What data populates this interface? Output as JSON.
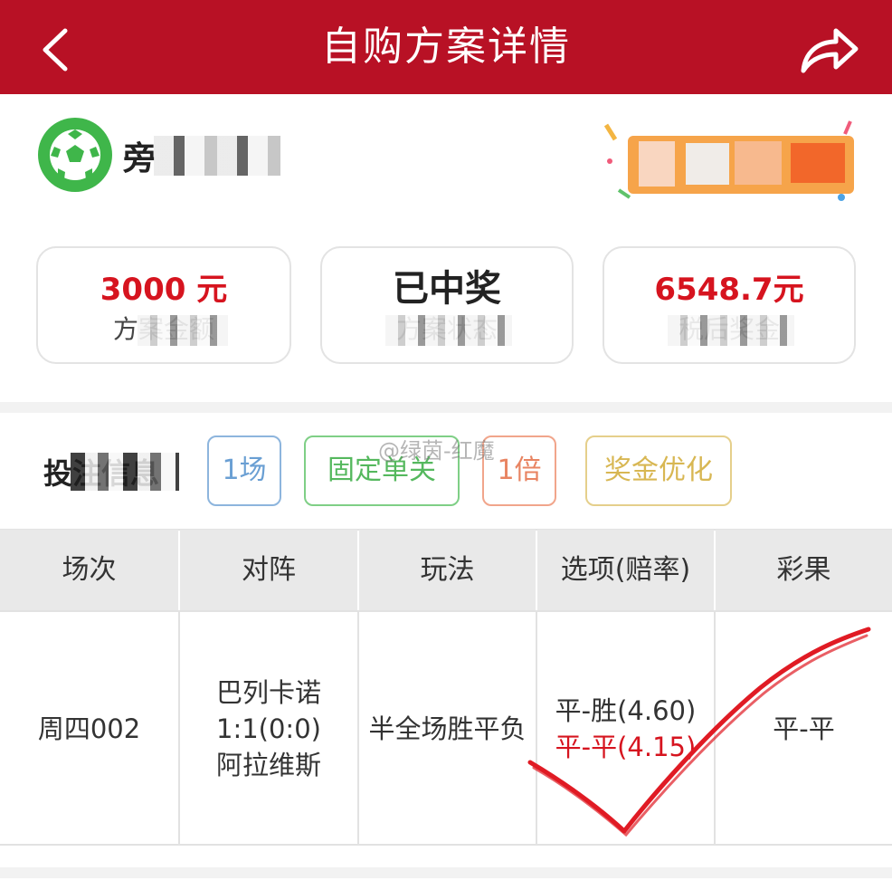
{
  "header": {
    "title": "自购方案详情",
    "back_icon": "chevron-left-icon",
    "share_icon": "share-icon",
    "bg_color": "#b81125"
  },
  "shop": {
    "icon": "soccer-ball-icon",
    "name": "旁"
  },
  "summary": [
    {
      "value": "3000 元",
      "label": "方案金额"
    },
    {
      "value": "已中奖",
      "label": "方案状态"
    },
    {
      "value": "6548.7元",
      "label": "税后奖金"
    }
  ],
  "filters": {
    "label": "投注信息",
    "tags": [
      "1场",
      "固定单关",
      "1倍",
      "奖金优化"
    ]
  },
  "watermark": "@绿茵-红魔",
  "table": {
    "headers": [
      "场次",
      "对阵",
      "玩法",
      "选项(赔率)",
      "彩果"
    ],
    "row": {
      "match_no": "周四002",
      "home": "巴列卡诺",
      "score": "1:1(0:0)",
      "away": "阿拉维斯",
      "play": "半全场胜平负",
      "option1": "平-胜(4.60)",
      "option2": "平-平(4.15)",
      "result": "平-平"
    }
  },
  "colors": {
    "accent_red": "#d6141f",
    "tag_blue": "#6a9fd3",
    "tag_green": "#55b85e",
    "tag_orange": "#e88462",
    "tag_gold": "#d8b753"
  }
}
